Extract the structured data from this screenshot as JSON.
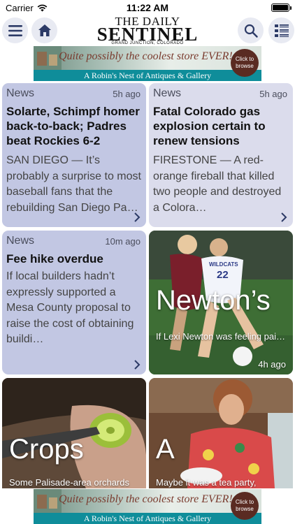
{
  "status": {
    "carrier": "Carrier",
    "time": "11:22 AM"
  },
  "nav": {
    "masthead_top": "THE DAILY",
    "masthead_main": "SENTINEL",
    "masthead_location": "GRAND JUNCTION, COLORADO"
  },
  "ad": {
    "top_text": "Quite possibly the coolest store EVER!",
    "bottom_text": "A Robin's Nest of Antiques & Gallery",
    "click_text": "Click to browse"
  },
  "cards": [
    {
      "category": "News",
      "time": "5h ago",
      "title": "Solarte, Schimpf homer back-to-back; Padres beat Rockies 6-2",
      "body": "SAN DIEGO — It’s probably a surprise to most baseball fans that the rebuilding San Diego Pa…"
    },
    {
      "category": "News",
      "time": "5h ago",
      "title": "Fatal Colorado gas explosion certain to renew tensions",
      "body": "FIRESTONE — A red-orange fireball that killed two people and destroyed a Colora…"
    },
    {
      "category": "News",
      "time": "10m ago",
      "title": "Fee hike overdue",
      "body": "If local builders hadn’t expressly supported a Mesa County proposal to raise the cost of obtaining buildi…"
    }
  ],
  "image_cards": [
    {
      "big": "Newton’s",
      "caption": "If Lexi Newton was feeling pain from the bloody nose…",
      "time": "4h ago",
      "jersey": "22",
      "jersey_team": "WILDCATS"
    },
    {
      "big": "Crops",
      "caption": "Some Palisade-area orchards"
    },
    {
      "big": "A",
      "caption": "Maybe it was a tea party,"
    }
  ],
  "colors": {
    "card_a": "#c2c7e3",
    "card_b": "#dbdcec",
    "nav_button": "#e8eaf2",
    "icon": "#2c3a66"
  }
}
